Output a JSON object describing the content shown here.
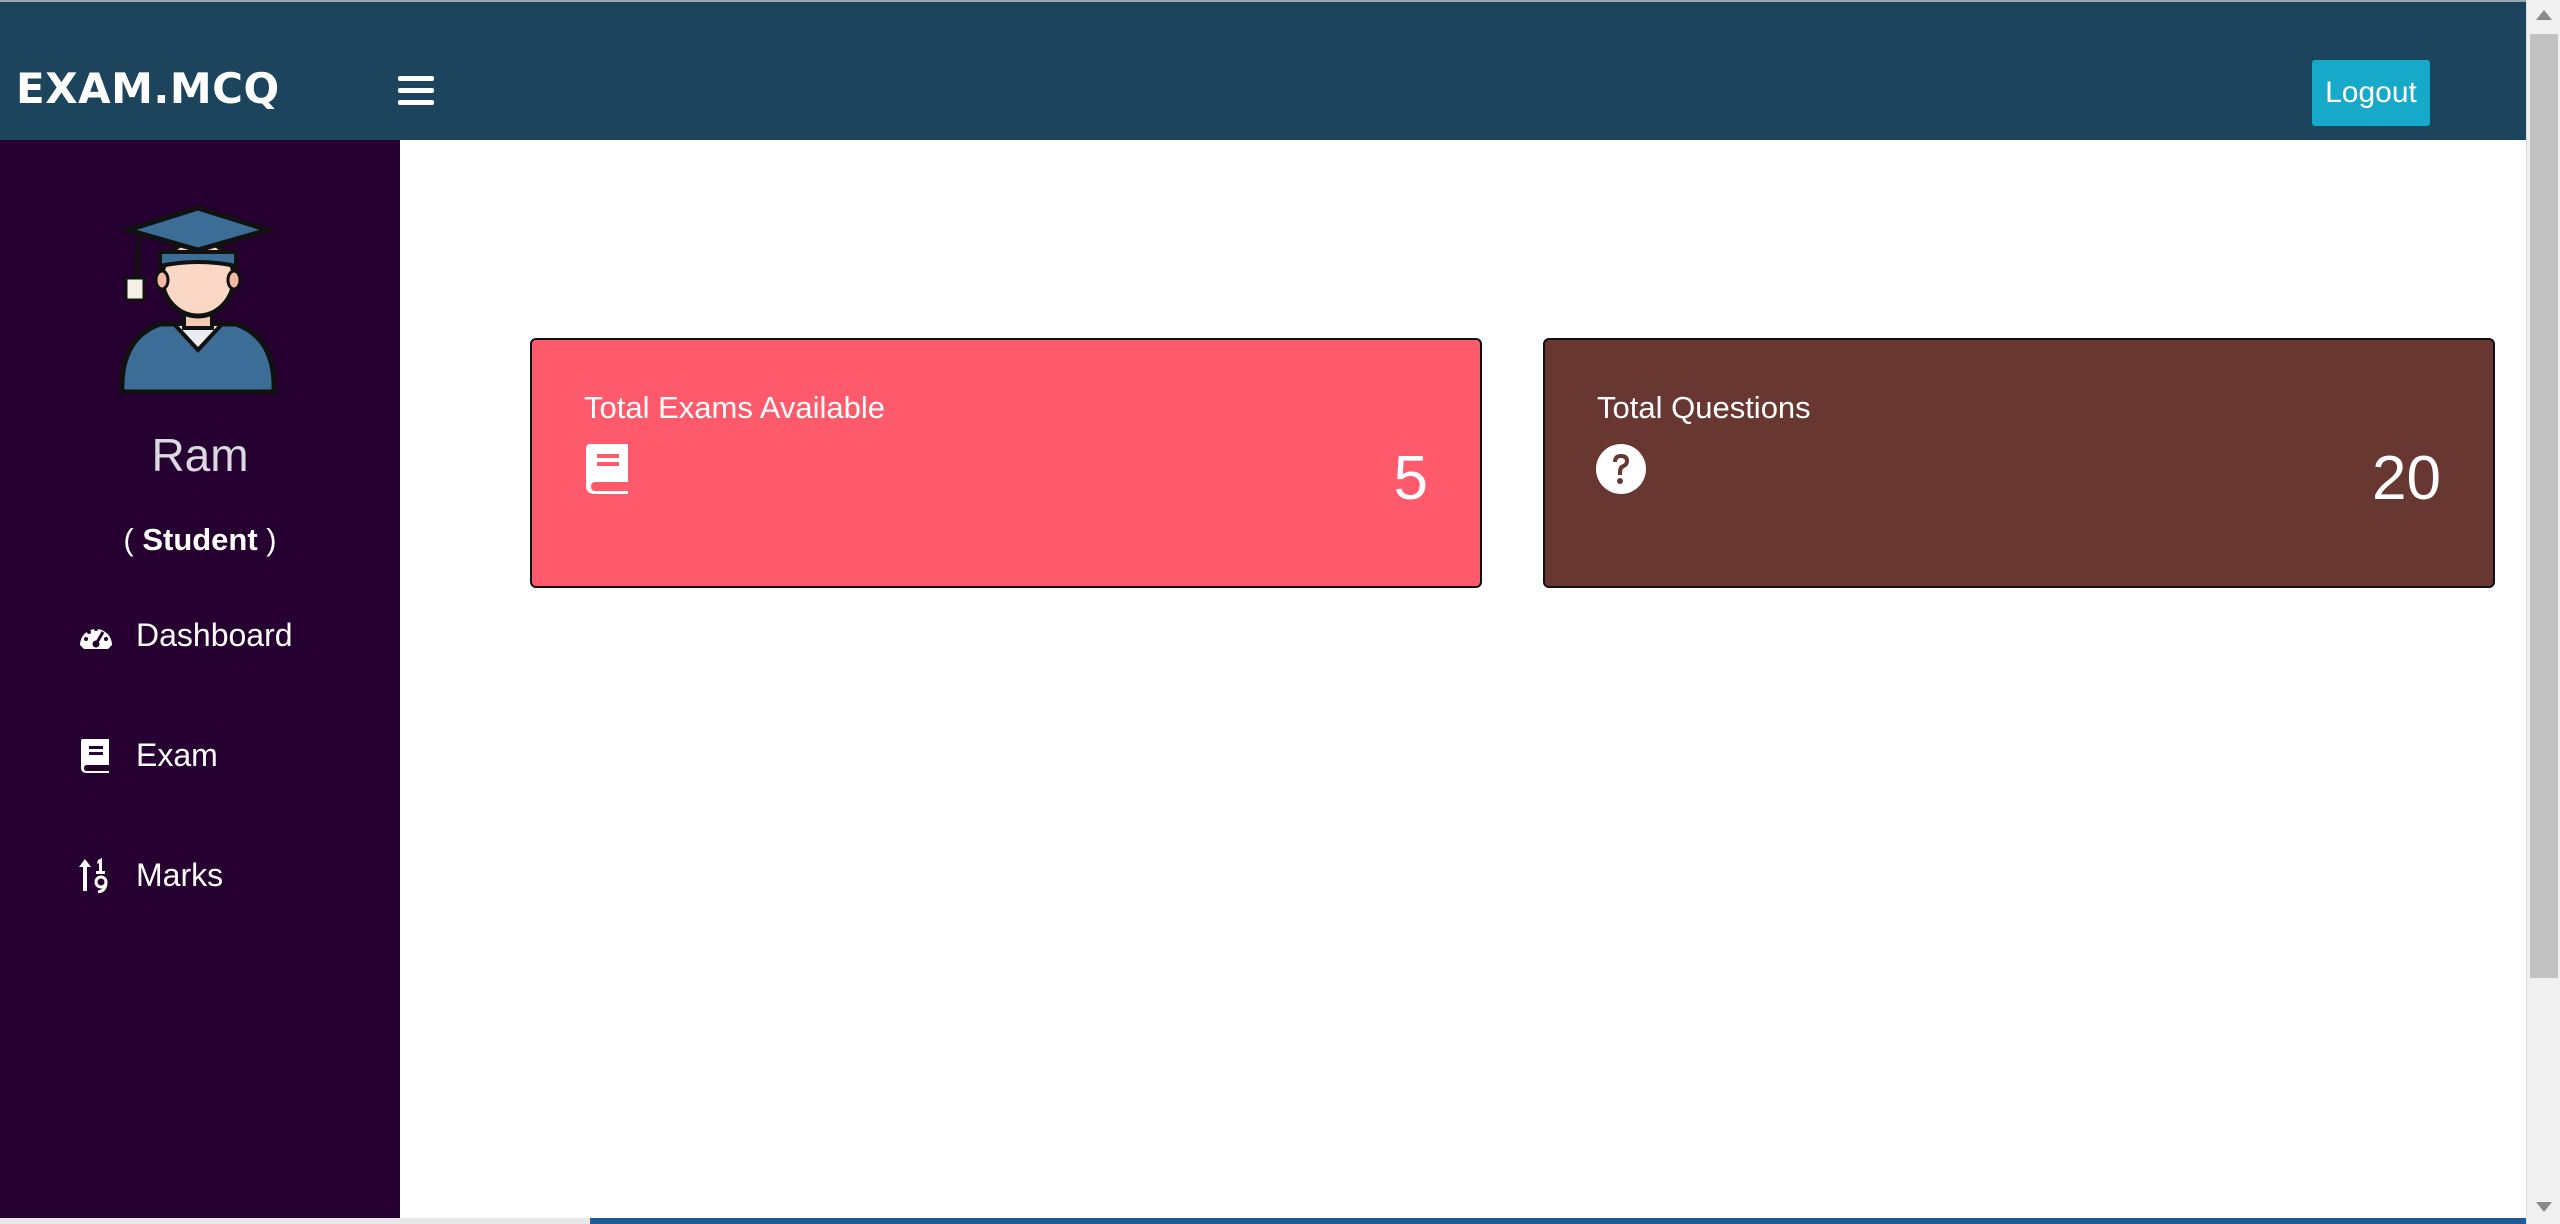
{
  "header": {
    "brand": "EXAM.MCQ",
    "menu_icon": "hamburger-menu-icon",
    "logout_label": "Logout"
  },
  "sidebar": {
    "avatar_icon": "graduate-student-avatar",
    "user_name": "Ram",
    "user_role": "Student",
    "items": [
      {
        "label": "Dashboard",
        "icon": "tachometer-icon"
      },
      {
        "label": "Exam",
        "icon": "book-icon"
      },
      {
        "label": "Marks",
        "icon": "sort-numeric-icon"
      }
    ]
  },
  "cards": [
    {
      "title": "Total Exams Available",
      "value": "5",
      "icon": "book-icon",
      "color": "#fe5a6b"
    },
    {
      "title": "Total Questions",
      "value": "20",
      "icon": "question-circle-icon",
      "color": "#693731"
    }
  ],
  "colors": {
    "topbar": "#1d445d",
    "sidebar": "#250030",
    "logout_button": "#17a9c9"
  }
}
